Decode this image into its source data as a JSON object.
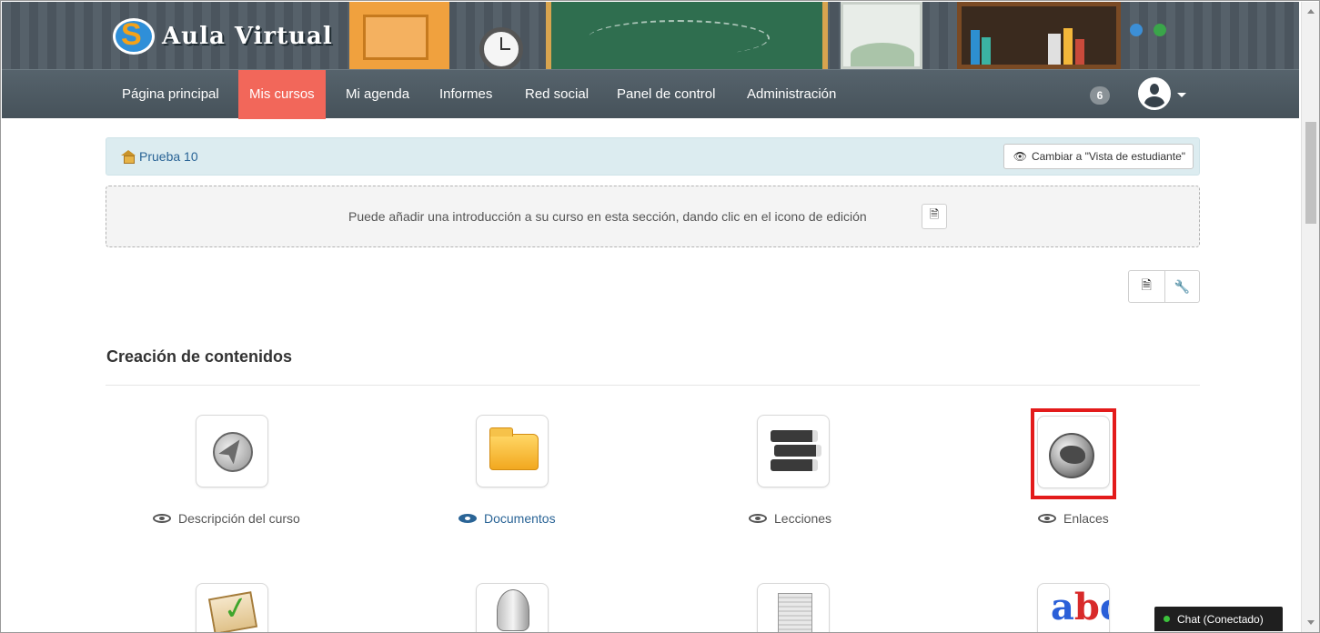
{
  "brand": {
    "name": "Aula Virtual"
  },
  "nav": {
    "items": [
      {
        "label": "Página principal",
        "active": false
      },
      {
        "label": "Mis cursos",
        "active": true
      },
      {
        "label": "Mi agenda",
        "active": false
      },
      {
        "label": "Informes",
        "active": false
      },
      {
        "label": "Red social",
        "active": false
      },
      {
        "label": "Panel de control",
        "active": false
      },
      {
        "label": "Administración",
        "active": false
      }
    ],
    "notification_count": "6"
  },
  "breadcrumb": {
    "course": "Prueba 10"
  },
  "student_view": {
    "label": "Cambiar a \"Vista de estudiante\""
  },
  "intro": {
    "text": "Puede añadir una introducción a su curso en esta sección, dando clic en el icono de edición"
  },
  "section": {
    "title": "Creación de contenidos"
  },
  "tools": [
    {
      "label": "Descripción del curso",
      "icon": "course-description-icon",
      "visible": false
    },
    {
      "label": "Documentos",
      "icon": "folder-icon",
      "visible": true
    },
    {
      "label": "Lecciones",
      "icon": "books-icon",
      "visible": false
    },
    {
      "label": "Enlaces",
      "icon": "globe-icon",
      "visible": false,
      "highlighted": true
    }
  ],
  "chat": {
    "label": "Chat (Conectado)"
  },
  "colors": {
    "nav_active": "#f2675a",
    "link": "#2a6496",
    "highlight": "#e31b1b"
  }
}
